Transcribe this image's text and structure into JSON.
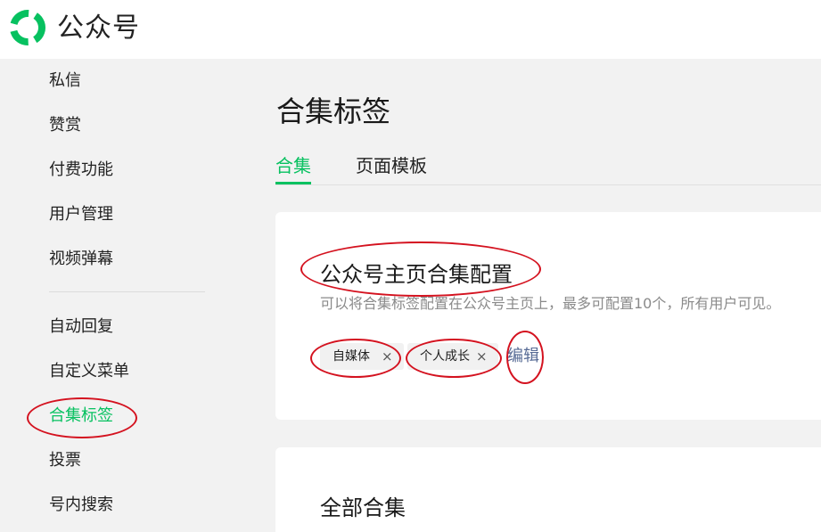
{
  "header": {
    "brand": "公众号"
  },
  "sidebar": {
    "items": [
      {
        "label": "私信"
      },
      {
        "label": "赞赏"
      },
      {
        "label": "付费功能"
      },
      {
        "label": "用户管理"
      },
      {
        "label": "视频弹幕"
      },
      {
        "label": "自动回复"
      },
      {
        "label": "自定义菜单"
      },
      {
        "label": "合集标签",
        "active": true
      },
      {
        "label": "投票"
      },
      {
        "label": "号内搜索"
      }
    ]
  },
  "main": {
    "title": "合集标签",
    "tabs": [
      {
        "label": "合集",
        "active": true
      },
      {
        "label": "页面模板"
      }
    ],
    "homepage_config": {
      "title": "公众号主页合集配置",
      "description": "可以将合集标签配置在公众号主页上，最多可配置10个，所有用户可见。",
      "tags": [
        {
          "label": "自媒体",
          "remove": "×"
        },
        {
          "label": "个人成长",
          "remove": "×"
        }
      ],
      "edit_label": "编辑"
    },
    "all_collections": {
      "title": "全部合集"
    }
  },
  "colors": {
    "accent": "#07c160",
    "link": "#576b95",
    "annotation": "#d4121f"
  },
  "icons": {
    "logo": "wechat-official-account-logo-icon",
    "tag_remove": "close-icon"
  }
}
